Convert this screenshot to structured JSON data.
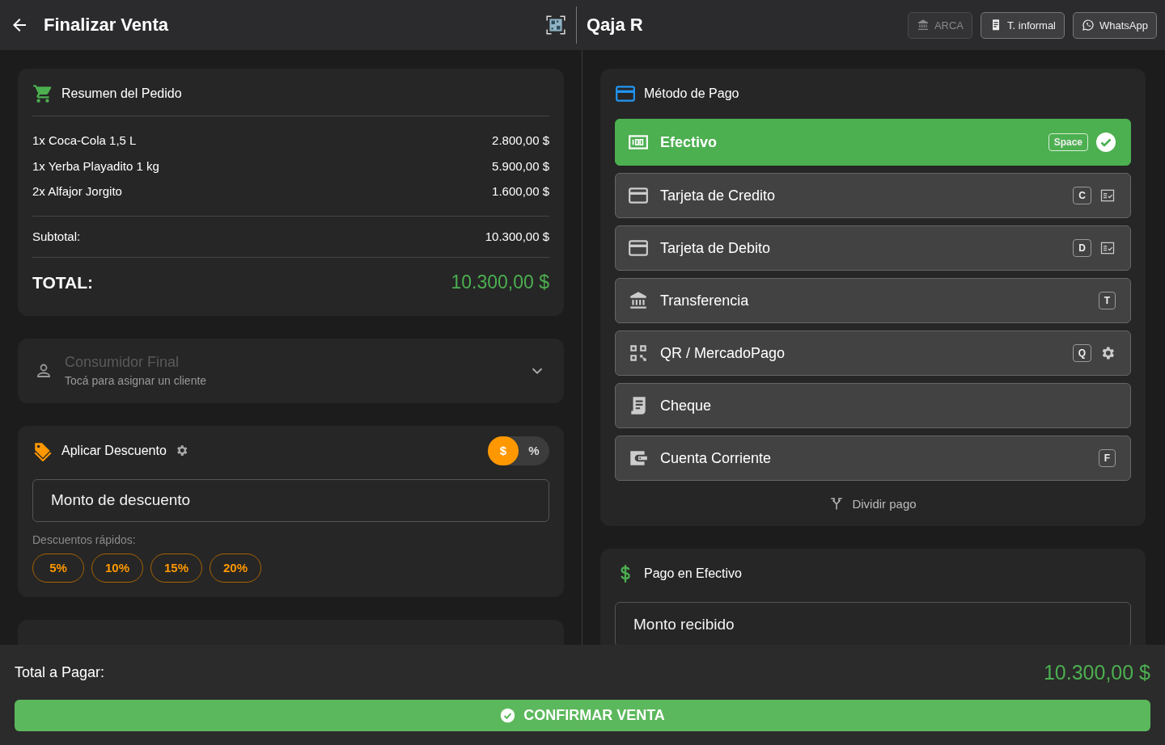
{
  "header": {
    "title": "Finalizar Venta",
    "store": "Qaja R",
    "actions": [
      {
        "label": "ARCA",
        "kind": "bank",
        "disabled": true
      },
      {
        "label": "T. informal",
        "kind": "receipt",
        "disabled": false
      },
      {
        "label": "WhatsApp",
        "kind": "chat",
        "disabled": false
      }
    ]
  },
  "order_summary": {
    "title": "Resumen del Pedido",
    "items": [
      {
        "name": "1x Coca-Cola 1,5 L",
        "amount": "2.800,00 $"
      },
      {
        "name": "1x Yerba Playadito 1 kg",
        "amount": "5.900,00 $"
      },
      {
        "name": "2x Alfajor Jorgito",
        "amount": "1.600,00 $"
      }
    ],
    "subtotal_label": "Subtotal:",
    "subtotal": "10.300,00 $",
    "total_label": "TOTAL:",
    "total": "10.300,00 $"
  },
  "customer": {
    "name": "Consumidor Final",
    "hint": "Tocá para asignar un cliente"
  },
  "discount": {
    "title": "Aplicar Descuento",
    "modes": [
      {
        "label": "$",
        "selected": true
      },
      {
        "label": "%",
        "selected": false
      }
    ],
    "placeholder": "Monto de descuento",
    "quick_label": "Descuentos rápidos:",
    "quick": [
      "5%",
      "10%",
      "15%",
      "20%"
    ]
  },
  "payment_methods": {
    "title": "Método de Pago",
    "methods": [
      {
        "label": "Efectivo",
        "kind": "cash",
        "shortcut": "Space",
        "details_button": false,
        "settings_button": false,
        "selected": true
      },
      {
        "label": "Tarjeta de Credito",
        "kind": "card",
        "shortcut": "C",
        "details_button": true,
        "settings_button": false,
        "selected": false
      },
      {
        "label": "Tarjeta de Debito",
        "kind": "card",
        "shortcut": "D",
        "details_button": true,
        "settings_button": false,
        "selected": false
      },
      {
        "label": "Transferencia",
        "kind": "bank",
        "shortcut": "T",
        "details_button": false,
        "settings_button": false,
        "selected": false
      },
      {
        "label": "QR / MercadoPago",
        "kind": "qr",
        "shortcut": "Q",
        "details_button": false,
        "settings_button": true,
        "selected": false
      },
      {
        "label": "Cheque",
        "kind": "cheque",
        "details_button": false,
        "settings_button": false,
        "selected": false
      },
      {
        "label": "Cuenta Corriente",
        "kind": "wallet",
        "shortcut": "F",
        "details_button": false,
        "settings_button": false,
        "selected": false
      }
    ],
    "split": "Dividir pago"
  },
  "cash_payment": {
    "title": "Pago en Efectivo",
    "placeholder": "Monto recibido"
  },
  "footer": {
    "label": "Total a Pagar:",
    "total": "10.300,00 $",
    "confirm": "CONFIRMAR VENTA"
  }
}
